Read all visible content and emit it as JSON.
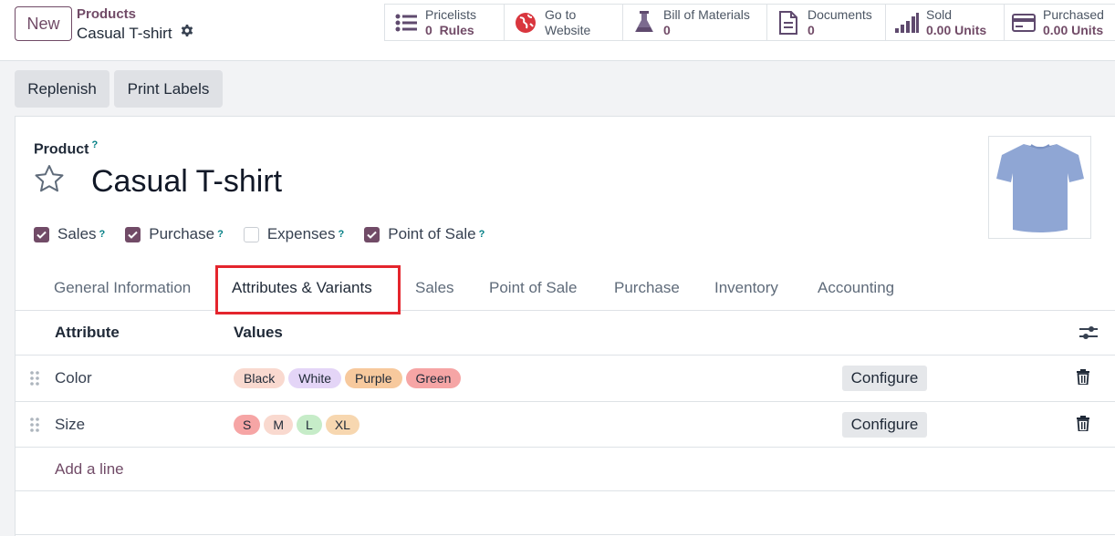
{
  "breadcrumb": {
    "new_label": "New",
    "parent": "Products",
    "current": "Casual T-shirt"
  },
  "smart_buttons": [
    {
      "icon": "list-icon",
      "line1": "Pricelists",
      "line2": "0  Rules"
    },
    {
      "icon": "globe-icon",
      "line1": "Go to",
      "line2": "Website"
    },
    {
      "icon": "flask-icon",
      "line1": "Bill of Materials",
      "line2": "0"
    },
    {
      "icon": "document-icon",
      "line1": "Documents",
      "line2": "0"
    },
    {
      "icon": "bar-chart-icon",
      "line1": "Sold",
      "line2": "0.00 Units"
    },
    {
      "icon": "credit-card-icon",
      "line1": "Purchased",
      "line2": "0.00 Units"
    }
  ],
  "actions": {
    "replenish": "Replenish",
    "print_labels": "Print Labels"
  },
  "product": {
    "label": "Product",
    "help": "?",
    "name": "Casual T-shirt",
    "image": "t-shirt-image",
    "checkboxes": [
      {
        "label": "Sales",
        "checked": true
      },
      {
        "label": "Purchase",
        "checked": true
      },
      {
        "label": "Expenses",
        "checked": false
      },
      {
        "label": "Point of Sale",
        "checked": true
      }
    ]
  },
  "tabs": [
    "General Information",
    "Attributes & Variants",
    "Sales",
    "Point of Sale",
    "Purchase",
    "Inventory",
    "Accounting"
  ],
  "active_tab": "Attributes & Variants",
  "attributes_table": {
    "headers": {
      "attribute": "Attribute",
      "values": "Values"
    },
    "rows": [
      {
        "attribute": "Color",
        "values": [
          {
            "label": "Black",
            "color": "#f9d9cf"
          },
          {
            "label": "White",
            "color": "#e4d5f7"
          },
          {
            "label": "Purple",
            "color": "#f7c99d"
          },
          {
            "label": "Green",
            "color": "#f6a5a5"
          }
        ],
        "configure": "Configure"
      },
      {
        "attribute": "Size",
        "values": [
          {
            "label": "S",
            "color": "#f6a5a5"
          },
          {
            "label": "M",
            "color": "#f9d9cf"
          },
          {
            "label": "L",
            "color": "#c6ecc8"
          },
          {
            "label": "XL",
            "color": "#f7d7b0"
          }
        ],
        "configure": "Configure"
      }
    ],
    "add_line": "Add a line"
  },
  "colors": {
    "brand": "#714b67",
    "highlight": "#e4252d",
    "help": "#017e84"
  }
}
